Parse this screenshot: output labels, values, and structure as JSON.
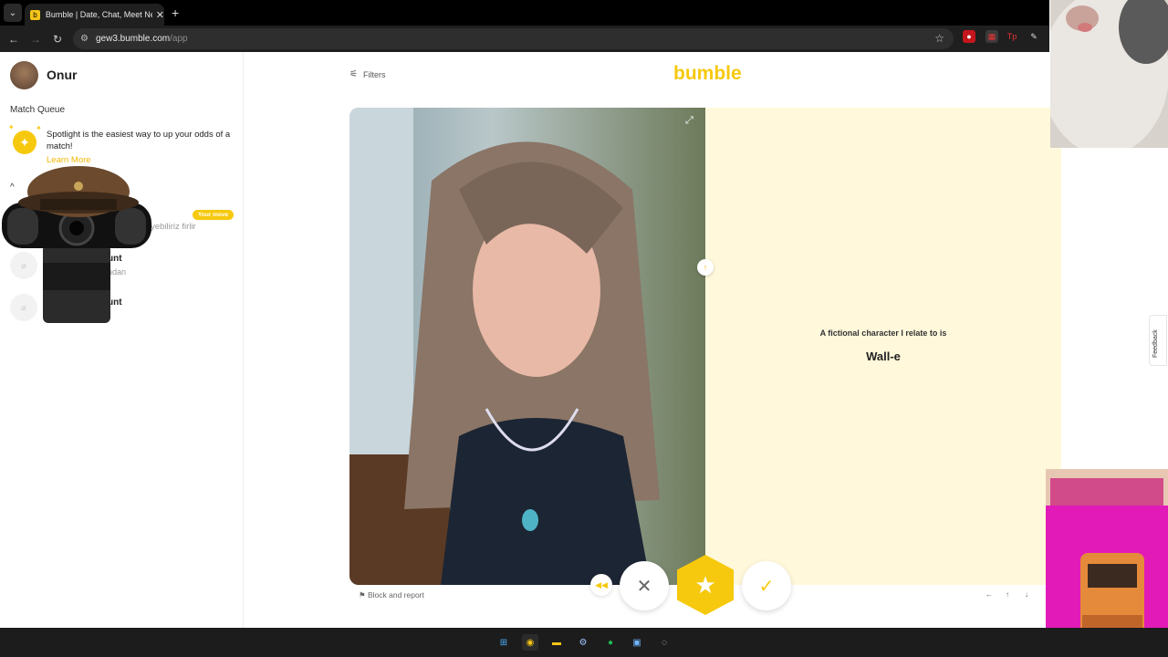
{
  "browser": {
    "tab_title": "Bumble | Date, Chat, Meet New People & Network Better",
    "url_host": "gew3.bumble.com",
    "url_path": "/app",
    "new_tab": "+",
    "tab_close": "✕"
  },
  "sidebar": {
    "user_name": "Onur",
    "match_queue_title": "Match Queue",
    "spotlight_text": "Spotlight is the easiest way to up your odds of a match!",
    "learn_more": "Learn More",
    "section_caret": "^",
    "your_move_badge": "Your move",
    "conversations": [
      {
        "name": "",
        "preview": "iyebiliriz firlir"
      },
      {
        "name": "unt",
        "preview": "adan"
      },
      {
        "name": "unt",
        "preview": ""
      }
    ]
  },
  "main": {
    "filters_label": "Filters",
    "logo": "bumble",
    "prompt_question": "A fictional character I relate to is",
    "prompt_answer": "Wall-e",
    "block_report": "Block and report",
    "keyboard_hints": [
      "←",
      "↑",
      "↓"
    ]
  },
  "feedback_label": "Feedback",
  "colors": {
    "brand": "#f6c90e",
    "prompt_bg": "#fff8db"
  }
}
